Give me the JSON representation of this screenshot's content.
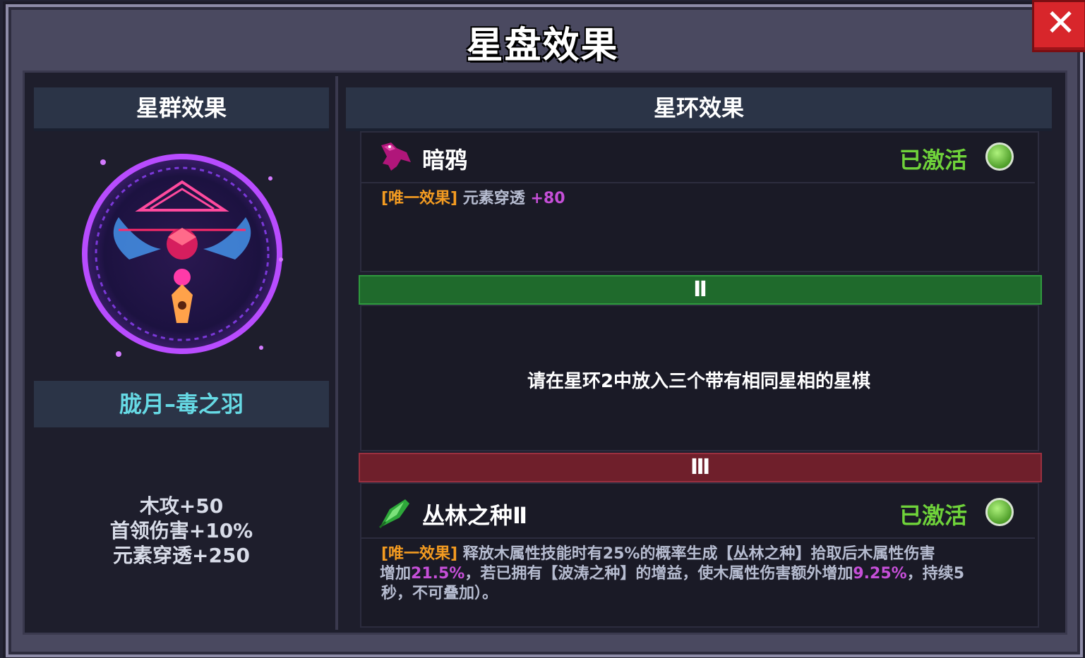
{
  "window": {
    "title": "星盘效果"
  },
  "left": {
    "header": "星群效果",
    "constellation_name": "胧月–毒之羽",
    "stats": [
      "木攻+50",
      "首领伤害+10%",
      "元素穿透+250"
    ]
  },
  "right": {
    "header": "星环效果",
    "ring1": {
      "name": "暗鸦",
      "status": "已激活",
      "icon": "crow-icon",
      "desc": {
        "tag": "[唯一效果]",
        "text": "元素穿透 ",
        "value": "+80"
      }
    },
    "ring2": {
      "label": "Ⅱ",
      "requirement": "请在星环2中放入三个带有相同星相的星棋"
    },
    "ring3": {
      "label": "Ⅲ",
      "name": "丛林之种Ⅱ",
      "status": "已激活",
      "icon": "leaf-crystal-icon",
      "desc": {
        "tag": "[唯一效果]",
        "line1": "释放木属性技能时有25%的概率生成【丛林之种】拾取后木属性伤害",
        "line2_pre": "增加",
        "line2_val1": "21.5%",
        "line2_mid": "，若已拥有【波涛之种】的增益，使木属性伤害额外增加",
        "line2_val2": "9.25%",
        "line2_post": "，持续5",
        "line3": "秒，不可叠加）。"
      }
    }
  },
  "colors": {
    "active": "#6fd23a",
    "highlight": "#c64fd8",
    "tag": "#f39b21",
    "ring2_bar": "#1f6a2c",
    "ring3_bar": "#6f1f2b"
  },
  "close": {
    "icon": "close-icon",
    "label": "✕"
  }
}
